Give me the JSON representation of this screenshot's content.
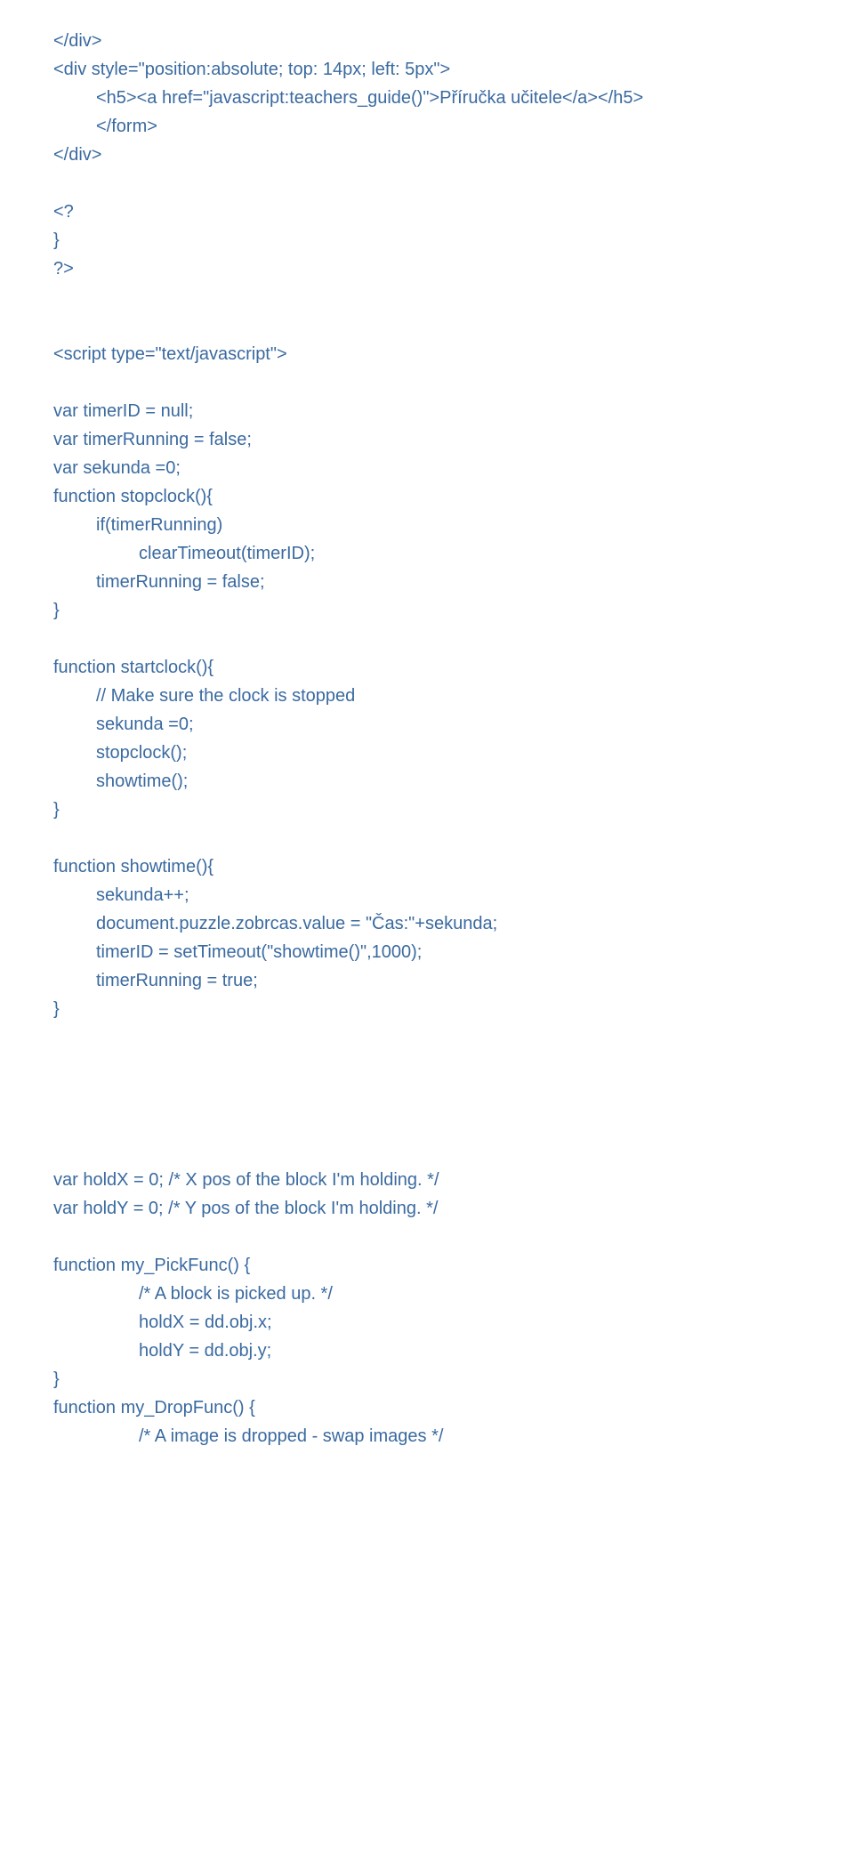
{
  "lines": {
    "l1": "</div>",
    "l2": "<div style=\"position:absolute; top: 14px; left: 5px\">",
    "l3": "<h5><a href=\"javascript:teachers_guide()\">Příručka učitele</a></h5>",
    "l4": "</form>",
    "l5": "</div>",
    "l6": "<?",
    "l7": "}",
    "l8": "?>",
    "l9": "<script type=\"text/javascript\">",
    "l10": "var timerID = null;",
    "l11": "var timerRunning = false;",
    "l12": "var sekunda =0;",
    "l13": "function stopclock(){",
    "l14": "if(timerRunning)",
    "l15": "clearTimeout(timerID);",
    "l16": "timerRunning = false;",
    "l17": "}",
    "l18": "function startclock(){",
    "l19": "// Make sure the clock is stopped",
    "l20": "sekunda =0;",
    "l21": "stopclock();",
    "l22": "showtime();",
    "l23": "}",
    "l24": "function showtime(){",
    "l25": "sekunda++;",
    "l26": "document.puzzle.zobrcas.value = \"Čas:\"+sekunda;",
    "l27": "timerID = setTimeout(\"showtime()\",1000);",
    "l28": "timerRunning = true;",
    "l29": "}",
    "l30": "var holdX = 0; /* X pos of the block I'm holding. */",
    "l31": "var holdY = 0; /* Y pos of the block I'm holding. */",
    "l32": "function my_PickFunc() {",
    "l33": "/* A block is picked up. */",
    "l34": "holdX = dd.obj.x;",
    "l35": "holdY = dd.obj.y;",
    "l36": "}",
    "l37": "function my_DropFunc() {",
    "l38": "/* A image is dropped - swap images */"
  }
}
